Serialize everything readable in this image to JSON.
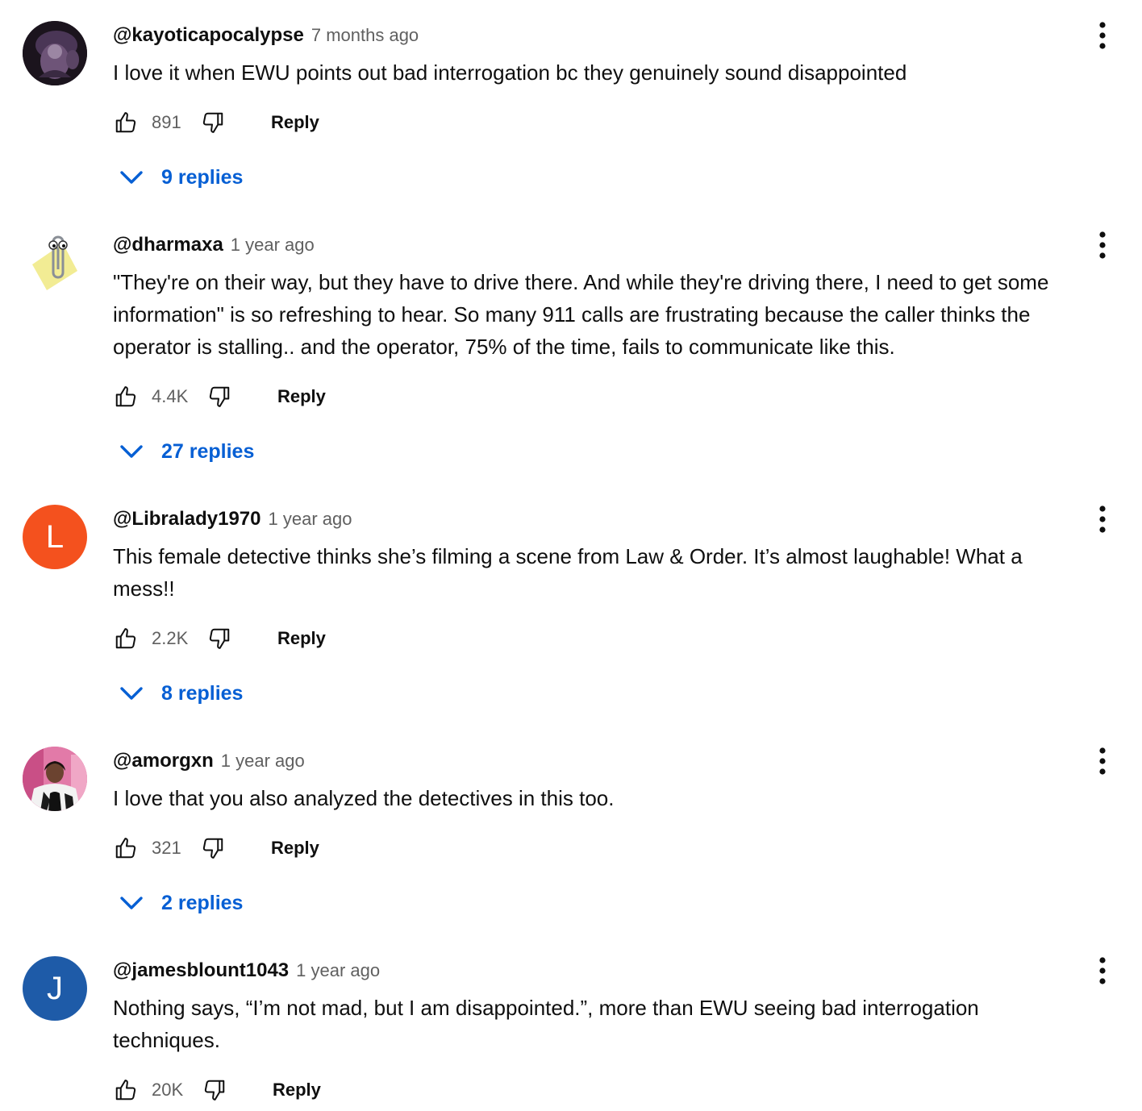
{
  "comments": [
    {
      "author": "@kayoticapocalypse",
      "time": "7 months ago",
      "lines": [
        "I love it when EWU points out bad interrogation bc they genuinely sound disappointed"
      ],
      "likes": "891",
      "reply_label": "Reply",
      "replies": "9 replies",
      "avatar": {
        "type": "image",
        "icon": "dark-purple-figure-avatar",
        "color": "#3a2a3a"
      }
    },
    {
      "author": "@dharmaxa",
      "time": "1 year ago",
      "lines": [
        "\"They're on their way, but they have to drive there. And while they're driving there, I need to get some",
        "information\" is so refreshing to hear. So many 911 calls are frustrating because the caller thinks the",
        "operator is stalling.. and the operator, 75% of the time, fails to communicate like this."
      ],
      "likes": "4.4K",
      "reply_label": "Reply",
      "replies": "27 replies",
      "avatar": {
        "type": "image",
        "icon": "paperclip-assistant-avatar",
        "color": "#f3ee9a"
      }
    },
    {
      "author": "@Libralady1970",
      "time": "1 year ago",
      "lines": [
        "This female detective thinks she’s filming a scene from Law & Order. It’s almost laughable! What a",
        "mess!!"
      ],
      "likes": "2.2K",
      "reply_label": "Reply",
      "replies": "8 replies",
      "avatar": {
        "type": "letter",
        "letter": "L",
        "color": "#f4511e"
      }
    },
    {
      "author": "@amorgxn",
      "time": "1 year ago",
      "lines": [
        "I love that you also analyzed the detectives in this too."
      ],
      "likes": "321",
      "reply_label": "Reply",
      "replies": "2 replies",
      "avatar": {
        "type": "image",
        "icon": "person-photo-avatar",
        "color": "#d86a9a"
      }
    },
    {
      "author": "@jamesblount1043",
      "time": "1 year ago",
      "lines": [
        "Nothing says, “I’m not mad, but I am disappointed.”, more than EWU seeing bad interrogation",
        "techniques."
      ],
      "likes": "20K",
      "reply_label": "Reply",
      "avatar": {
        "type": "letter",
        "letter": "J",
        "color": "#1e5ba8"
      }
    }
  ],
  "colors": {
    "link": "#065fd4",
    "meta": "#606060",
    "text": "#0f0f0f"
  }
}
